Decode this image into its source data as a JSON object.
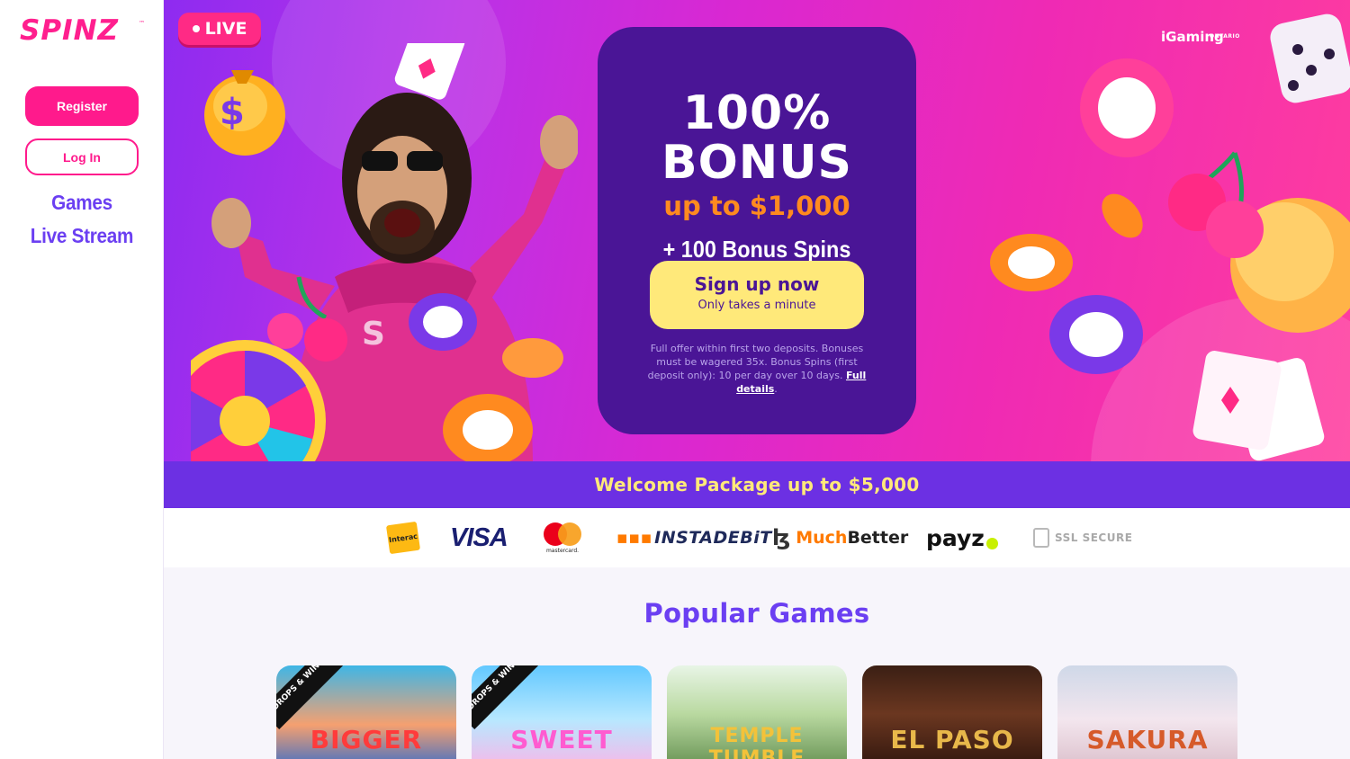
{
  "brand": {
    "logo_text": "SPINZ",
    "trademark": "™",
    "primary_color": "#ff1a8c",
    "accent_color": "#6b3ff2"
  },
  "sidebar": {
    "register_label": "Register",
    "login_label": "Log In",
    "nav": [
      {
        "label": "Games"
      },
      {
        "label": "Live Stream"
      }
    ]
  },
  "hero": {
    "live_badge": "LIVE",
    "regulator_small": "ONTARIO",
    "regulator": "iGaming",
    "offer": {
      "line1": "100%",
      "line2": "BONUS",
      "up_to": "up to $1,000",
      "spins": "+ 100 Bonus Spins",
      "cta_label": "Sign up now",
      "cta_sub": "Only takes a minute",
      "terms": "Full offer within first two deposits. Bonuses must be wagered 35x. Bonus Spins (first deposit only): 10 per day over 10 days.",
      "terms_link": "Full details",
      "terms_end": "."
    }
  },
  "welcome": {
    "text": "Welcome Package up to $5,000"
  },
  "payments": {
    "interac": "Interac",
    "visa": "VISA",
    "mastercard": "mastercard.",
    "instadebit": "INSTADEBiT",
    "muchbetter_a": "Much",
    "muchbetter_b": "Better",
    "payz": "payz",
    "ssl": "SSL SECURE"
  },
  "games": {
    "title": "Popular Games",
    "ribbon": "DROPS & WINS",
    "items": [
      {
        "name": "BIGGER",
        "ribbon": true
      },
      {
        "name": "SWEET",
        "ribbon": true
      },
      {
        "name": "TEMPLE TUMBLE",
        "ribbon": false
      },
      {
        "name": "EL PASO",
        "ribbon": false
      },
      {
        "name": "SAKURA",
        "ribbon": false
      }
    ]
  }
}
